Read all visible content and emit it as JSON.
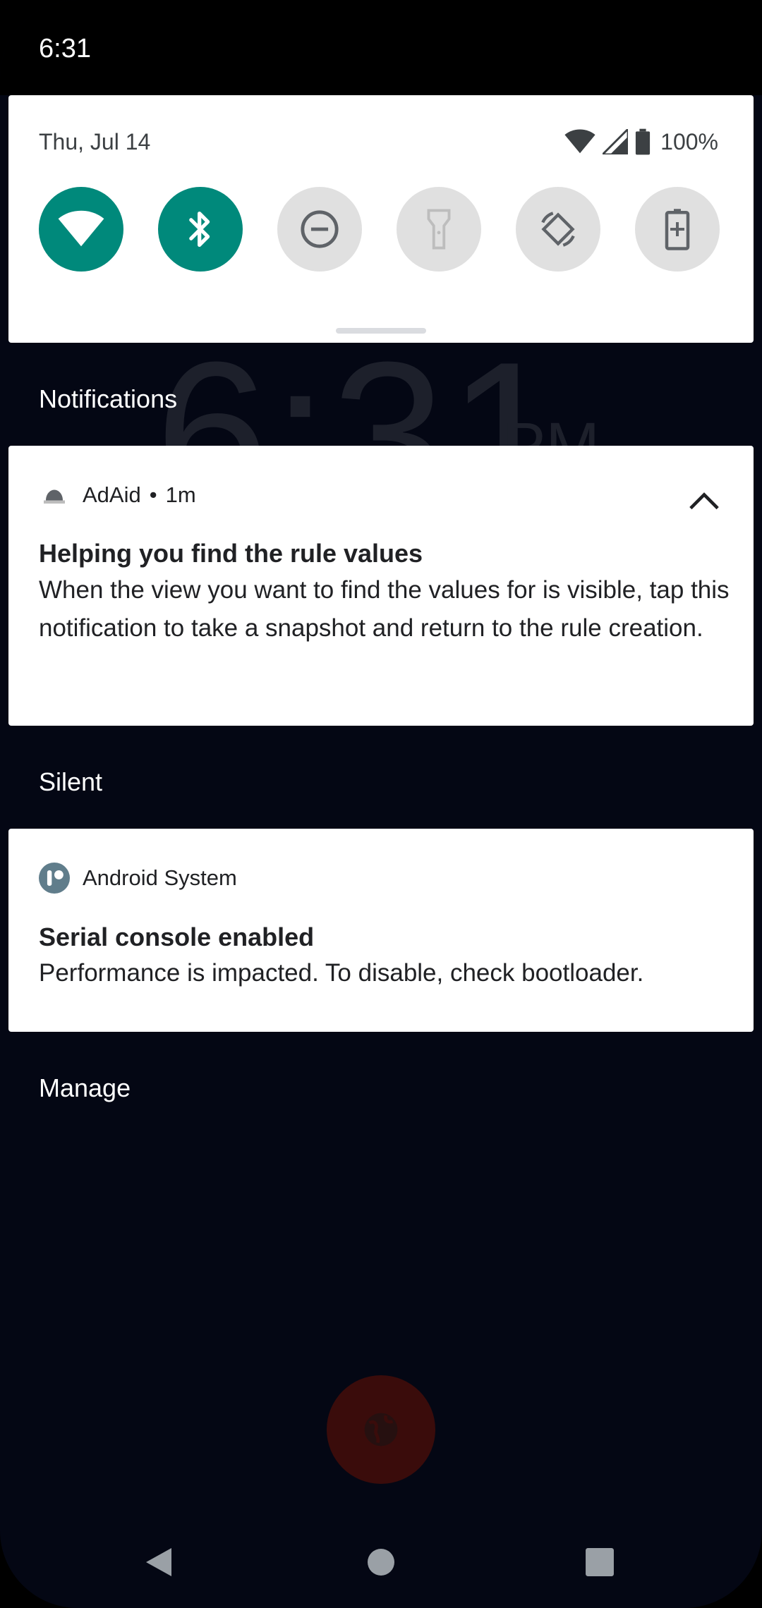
{
  "status_bar": {
    "time": "6:31"
  },
  "quick_settings": {
    "date": "Thu, Jul 14",
    "battery_percent": "100%",
    "tiles": [
      {
        "name": "wifi",
        "icon": "wifi-icon",
        "state": "on"
      },
      {
        "name": "bluetooth",
        "icon": "bluetooth-icon",
        "state": "on"
      },
      {
        "name": "do-not-disturb",
        "icon": "dnd-icon",
        "state": "off"
      },
      {
        "name": "flashlight",
        "icon": "flashlight-icon",
        "state": "off"
      },
      {
        "name": "auto-rotate",
        "icon": "rotate-icon",
        "state": "off"
      },
      {
        "name": "battery-saver",
        "icon": "battery-saver-icon",
        "state": "off"
      }
    ]
  },
  "background_clock": {
    "time": "6:31",
    "ampm": "PM"
  },
  "sections": {
    "notifications": "Notifications",
    "silent": "Silent",
    "manage": "Manage"
  },
  "notifications": [
    {
      "app": "AdAid",
      "separator": "•",
      "time": "1m",
      "title": "Helping you find the rule values",
      "text": "When the view you want to find the values for is visible, tap this notification to take a snapshot and return to the rule creation."
    },
    {
      "app": "Android System",
      "title": "Serial console enabled",
      "text": "Performance is impacted. To disable, check bootloader."
    }
  ],
  "colors": {
    "accent": "#00897b",
    "tile_off": "#e0e0e0",
    "background": "#040714"
  }
}
